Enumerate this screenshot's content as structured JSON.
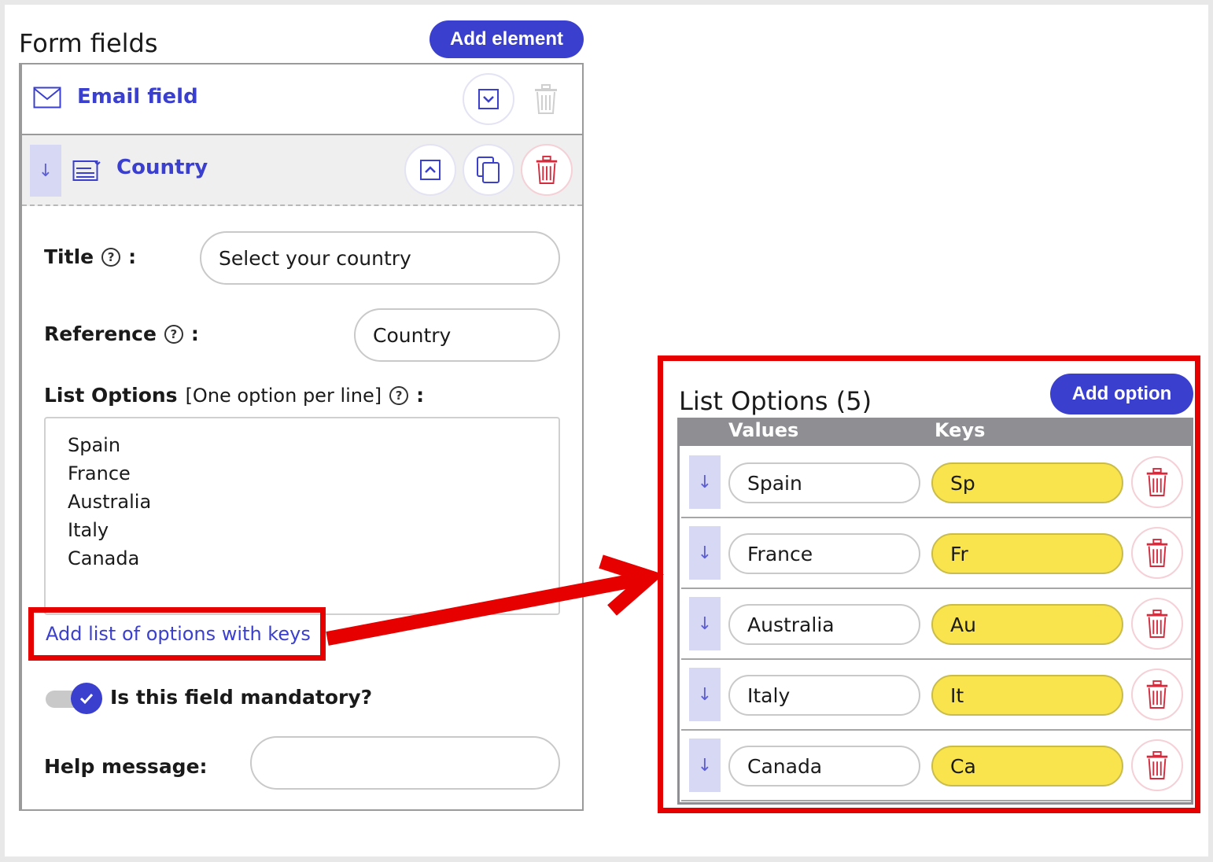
{
  "form_fields": {
    "title": "Form fields",
    "add_element_label": "Add element"
  },
  "email_field": {
    "label": "Email field",
    "icon": "envelope-icon"
  },
  "country_field": {
    "label": "Country",
    "icon": "select-list-icon",
    "drag_glyph": "↓",
    "title_label": "Title",
    "title_value": "Select your country",
    "reference_label": "Reference",
    "reference_value": "Country",
    "list_options_label": "List Options",
    "list_options_hint": "[One option per line]",
    "colon": ":",
    "help_glyph": "?",
    "options_text": [
      "Spain",
      "France",
      "Australia",
      "Italy",
      "Canada"
    ],
    "add_keys_link": "Add list of options with keys",
    "mandatory_label": "Is this field mandatory?",
    "mandatory_checked": true,
    "help_message_label": "Help message:",
    "help_message_value": ""
  },
  "list_options_panel": {
    "title": "List Options (5)",
    "add_option_label": "Add option",
    "col_values": "Values",
    "col_keys": "Keys",
    "rows": [
      {
        "value": "Spain",
        "key": "Sp"
      },
      {
        "value": "France",
        "key": "Fr"
      },
      {
        "value": "Australia",
        "key": "Au"
      },
      {
        "value": "Italy",
        "key": "It"
      },
      {
        "value": "Canada",
        "key": "Ca"
      }
    ]
  },
  "colors": {
    "accent": "#3b3fce",
    "highlight_red": "#e60000",
    "key_yellow": "#f9e44e",
    "delete_red": "#d62a3d"
  }
}
